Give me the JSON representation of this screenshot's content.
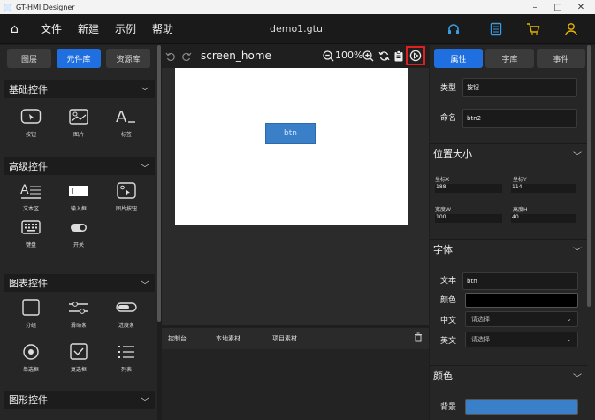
{
  "window": {
    "title": "GT-HMI Designer",
    "min": "–",
    "max": "□",
    "close": "✕"
  },
  "menu": {
    "home_glyph": "⌂",
    "items": [
      {
        "label": "文件"
      },
      {
        "label": "新建"
      },
      {
        "label": "示例"
      },
      {
        "label": "帮助"
      }
    ],
    "document": "demo1.gtui",
    "right_icons": [
      "headset-icon",
      "book-icon",
      "cart-icon",
      "user-icon"
    ]
  },
  "left_panel": {
    "tabs": [
      {
        "label": "图层",
        "active": false
      },
      {
        "label": "元件库",
        "active": true
      },
      {
        "label": "资源库",
        "active": false
      }
    ],
    "sections": [
      {
        "title": "基础控件",
        "tools": [
          {
            "label": "按钮",
            "icon": "button-icon"
          },
          {
            "label": "图片",
            "icon": "image-icon"
          },
          {
            "label": "标签",
            "icon": "label-icon"
          }
        ]
      },
      {
        "title": "高级控件",
        "tools": [
          {
            "label": "文本区",
            "icon": "textarea-icon"
          },
          {
            "label": "输入框",
            "icon": "input-box-icon"
          },
          {
            "label": "图片按钮",
            "icon": "image-button-icon"
          },
          {
            "label": "键盘",
            "icon": "keyboard-icon"
          },
          {
            "label": "开关",
            "icon": "switch-icon"
          }
        ]
      },
      {
        "title": "图表控件",
        "tools": [
          {
            "label": "分组",
            "icon": "group-icon"
          },
          {
            "label": "滑动条",
            "icon": "slider-icon"
          },
          {
            "label": "进度条",
            "icon": "progress-icon"
          },
          {
            "label": "单选框",
            "icon": "radio-icon"
          },
          {
            "label": "复选框",
            "icon": "checkbox-icon"
          },
          {
            "label": "列表",
            "icon": "list-icon"
          }
        ]
      },
      {
        "title": "图形控件",
        "tools": []
      }
    ]
  },
  "center": {
    "screen_name": "screen_home",
    "zoom": "100%",
    "widget_label": "btn",
    "bottom_tabs": [
      "控制台",
      "本地素材",
      "项目素材"
    ]
  },
  "right_panel": {
    "tabs": [
      {
        "label": "属性",
        "active": true
      },
      {
        "label": "字库",
        "active": false
      },
      {
        "label": "事件",
        "active": false
      }
    ],
    "type_label": "类型",
    "type_value": "按钮",
    "name_label": "命名",
    "name_value": "btn2",
    "position_section": "位置大小",
    "x_label": "坐标X",
    "x_value": "188",
    "y_label": "坐标Y",
    "y_value": "114",
    "w_label": "宽度W",
    "w_value": "100",
    "h_label": "高度H",
    "h_value": "40",
    "font_section": "字体",
    "text_label": "文本",
    "text_value": "btn",
    "color_label": "颜色",
    "color_value": "#000000",
    "cn_label": "中文",
    "cn_placeholder": "请选择",
    "en_label": "英文",
    "en_placeholder": "请选择",
    "color_section": "颜色",
    "bg_label": "背景",
    "bg_value": "#3a80c9"
  },
  "colors": {
    "accent": "#1f6fe0",
    "highlight": "#e02020",
    "icon_yellow": "#e6b400",
    "icon_blue": "#3a9be0"
  }
}
